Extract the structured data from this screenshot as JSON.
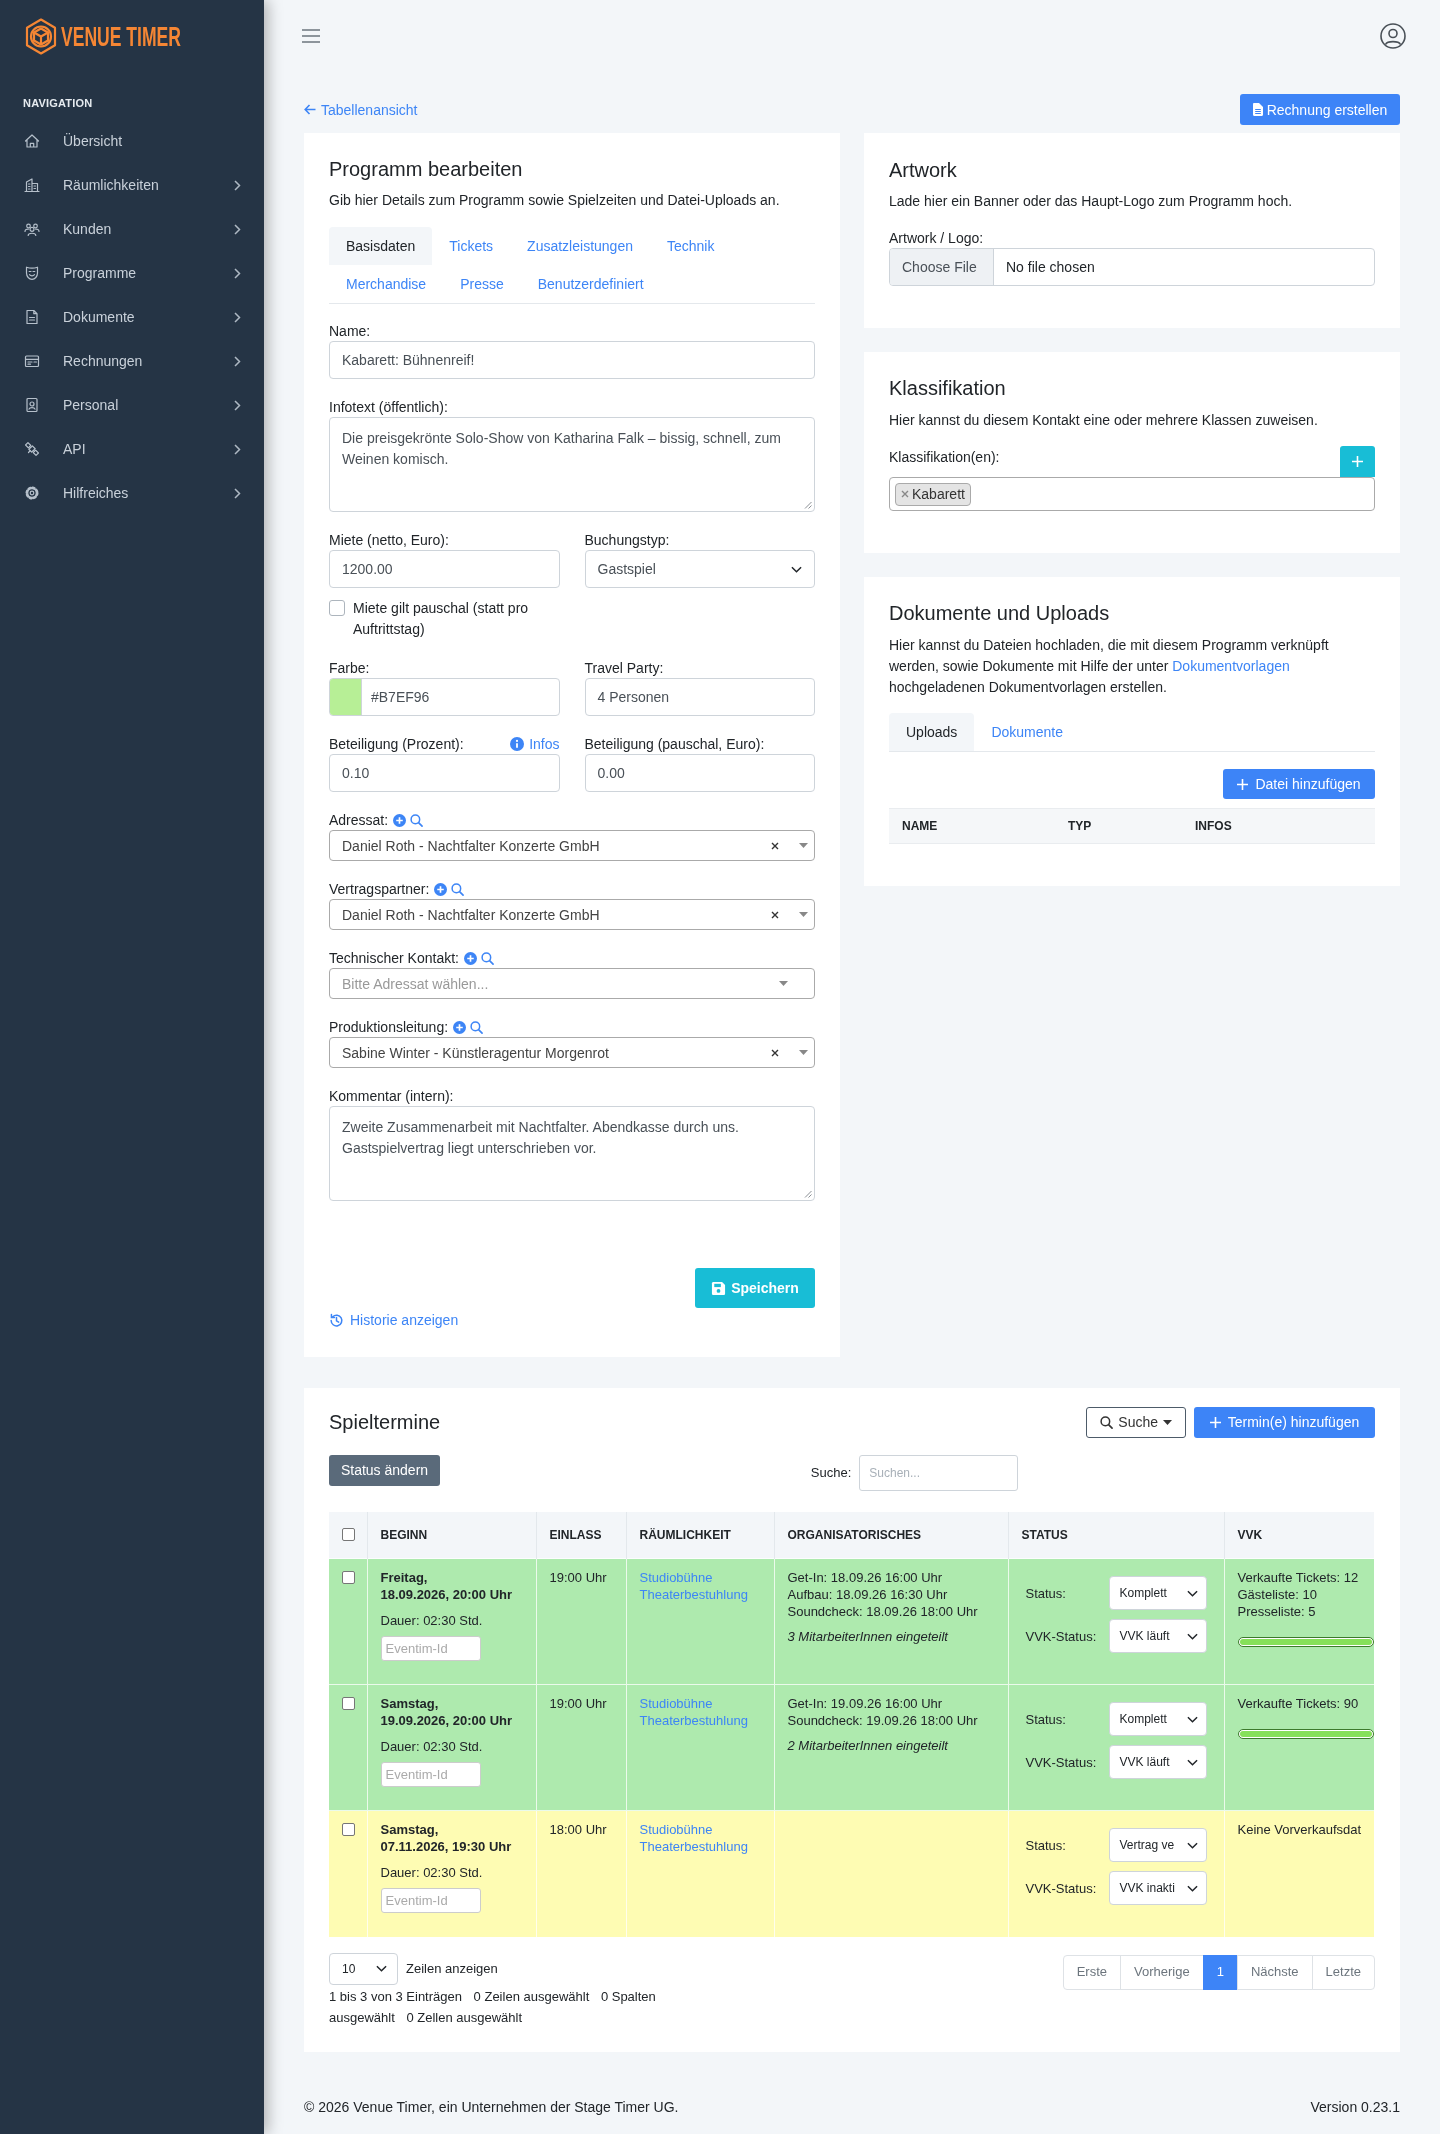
{
  "sidebar": {
    "logo": "VENUE TIMER",
    "heading": "NAVIGATION",
    "items": [
      {
        "label": "Übersicht",
        "submenu": false,
        "selected": false
      },
      {
        "label": "Räumlichkeiten",
        "submenu": true,
        "selected": false
      },
      {
        "label": "Kunden",
        "submenu": true,
        "selected": false
      },
      {
        "label": "Programme",
        "submenu": true,
        "selected": false
      },
      {
        "label": "Dokumente",
        "submenu": true,
        "selected": false
      },
      {
        "label": "Rechnungen",
        "submenu": true,
        "selected": false
      },
      {
        "label": "Personal",
        "submenu": true,
        "selected": false
      },
      {
        "label": "API",
        "submenu": true,
        "selected": false
      },
      {
        "label": "Hilfreiches",
        "submenu": true,
        "selected": false
      }
    ]
  },
  "toolbar": {
    "back_link": "Tabellenansicht",
    "invoice_button": "Rechnung erstellen"
  },
  "program_form": {
    "title": "Programm bearbeiten",
    "description": "Gib hier Details zum Programm sowie Spielzeiten und Datei-Uploads an.",
    "tabs": [
      {
        "label": "Basisdaten",
        "selected": true
      },
      {
        "label": "Tickets",
        "selected": false
      },
      {
        "label": "Zusatzleistungen",
        "selected": false
      },
      {
        "label": "Technik",
        "selected": false
      },
      {
        "label": "Merchandise",
        "selected": false
      },
      {
        "label": "Presse",
        "selected": false
      },
      {
        "label": "Benutzerdefiniert",
        "selected": false
      }
    ],
    "rows": [
      [
        [
          {
            "kind": "text",
            "label": "Name:",
            "value": "Kabarett: Bühnenreif!"
          }
        ]
      ],
      [
        [
          {
            "kind": "textarea",
            "label": "Infotext (öffentlich):",
            "value": "Die preisgekrönte Solo-Show von Katharina Falk – bissig, schnell, zum Weinen komisch."
          }
        ]
      ],
      [
        [
          {
            "kind": "text",
            "label": "Miete (netto, Euro):",
            "value": "1200.00"
          },
          {
            "kind": "checkbox",
            "label": "Miete gilt pauschal (statt pro Auftrittstag)",
            "checked": false
          }
        ],
        [
          {
            "kind": "dropdown",
            "label": "Buchungstyp:",
            "value": "Gastspiel"
          }
        ]
      ],
      [
        [
          {
            "kind": "color",
            "label": "Farbe:",
            "value": "#B7EF96"
          }
        ],
        [
          {
            "kind": "text",
            "label": "Travel Party:",
            "value": "4 Personen"
          }
        ]
      ],
      [
        [
          {
            "kind": "text",
            "label": "Beteiligung (Prozent):",
            "value": "0.10",
            "info_link": "Infos"
          }
        ],
        [
          {
            "kind": "text",
            "label": "Beteiligung (pauschal, Euro):",
            "value": "0.00"
          }
        ]
      ],
      [
        [
          {
            "kind": "contact",
            "label": "Adressat:",
            "value": "Daniel Roth - Nachtfalter Konzerte GmbH"
          }
        ]
      ],
      [
        [
          {
            "kind": "contact",
            "label": "Vertragspartner:",
            "value": "Daniel Roth - Nachtfalter Konzerte GmbH"
          }
        ]
      ],
      [
        [
          {
            "kind": "contact",
            "label": "Technischer Kontakt:",
            "placeholder": "Bitte Adressat wählen..."
          }
        ]
      ],
      [
        [
          {
            "kind": "contact",
            "label": "Produktionsleitung:",
            "value": "Sabine Winter - Künstleragentur Morgenrot"
          }
        ]
      ],
      [
        [
          {
            "kind": "textarea",
            "label": "Kommentar (intern):",
            "value": "Zweite Zusammenarbeit mit Nachtfalter. Abendkasse durch uns. Gastspielvertrag liegt unterschrieben vor."
          }
        ]
      ]
    ],
    "save_button": "Speichern",
    "history_link": "Historie anzeigen"
  },
  "artwork": {
    "title": "Artwork",
    "description": "Lade hier ein Banner oder das Haupt-Logo zum Programm hoch.",
    "label": "Artwork / Logo:",
    "file_button": "Choose File",
    "file_status": "No file chosen"
  },
  "classification": {
    "title": "Klassifikation",
    "description": "Hier kannst du diesem Kontakt eine oder mehrere Klassen zuweisen.",
    "label": "Klassifikation(en):",
    "tags": [
      "Kabarett"
    ]
  },
  "documents": {
    "title": "Dokumente und Uploads",
    "description": {
      "before": "Hier kannst du Dateien hochladen, die mit diesem Programm verknüpft werden, sowie Dokumente mit Hilfe der unter",
      "link": "Dokumentvorlagen",
      "after": "hochgeladenen Dokumentvorlagen erstellen."
    },
    "tabs": [
      {
        "label": "Uploads",
        "selected": true
      },
      {
        "label": "Dokumente",
        "selected": false
      }
    ],
    "add_button": "Datei hinzufügen",
    "columns": [
      "NAME",
      "TYP",
      "INFOS"
    ]
  },
  "schedule": {
    "title": "Spieltermine",
    "search_button": "Suche",
    "add_button": "Termin(e) hinzufügen",
    "status_button": "Status ändern",
    "search_label": "Suche:",
    "search_placeholder": "Suchen...",
    "select_all_checked": false,
    "columns": [
      "BEGINN",
      "EINLASS",
      "RÄUMLICHKEIT",
      "ORGANISATORISCHES",
      "STATUS",
      "VVK"
    ],
    "rows": [
      {
        "color": "#aeeaae",
        "checked": false,
        "day": "Freitag,",
        "datetime": "18.09.2026, 20:00 Uhr",
        "duration": "Dauer: 02:30 Std.",
        "eventim_placeholder": "Eventim-Id",
        "admission": "19:00 Uhr",
        "venue": "Studiobühne Theaterbestuhlung",
        "organisation": [
          "Get-In: 18.09.26 16:00 Uhr",
          "Aufbau: 18.09.26 16:30 Uhr",
          "Soundcheck: 18.09.26 18:00 Uhr"
        ],
        "staff": "3 MitarbeiterInnen eingeteilt",
        "status_label": "Status:",
        "status": "Komplett",
        "vvk_status_label": "VVK-Status:",
        "vvk_status": "VVK läuft",
        "sales": [
          "Verkaufte Tickets: 12",
          "Gästeliste: 10",
          "Presseliste: 5"
        ],
        "sales_bar": {
          "level": 1
        }
      },
      {
        "color": "#aeeaae",
        "checked": false,
        "day": "Samstag,",
        "datetime": "19.09.2026, 20:00 Uhr",
        "duration": "Dauer: 02:30 Std.",
        "eventim_placeholder": "Eventim-Id",
        "admission": "19:00 Uhr",
        "venue": "Studiobühne Theaterbestuhlung",
        "organisation": [
          "Get-In: 19.09.26 16:00 Uhr",
          "Soundcheck: 19.09.26 18:00 Uhr"
        ],
        "staff": "2 MitarbeiterInnen eingeteilt",
        "status_label": "Status:",
        "status": "Komplett",
        "vvk_status_label": "VVK-Status:",
        "vvk_status": "VVK läuft",
        "sales": [
          "Verkaufte Tickets: 90"
        ],
        "sales_bar": {
          "level": 1
        }
      },
      {
        "color": "#fefcb3",
        "checked": false,
        "day": "Samstag,",
        "datetime": "07.11.2026, 19:30 Uhr",
        "duration": "Dauer: 02:30 Std.",
        "eventim_placeholder": "Eventim-Id",
        "admission": "18:00 Uhr",
        "venue": "Studiobühne Theaterbestuhlung",
        "status_label": "Status:",
        "status": "Vertrag ve",
        "vvk_status_label": "VVK-Status:",
        "vvk_status": "VVK inakti",
        "sales": [
          "Keine Vorverkaufsdat"
        ]
      }
    ],
    "page_length": "10",
    "page_length_label": "Zeilen anzeigen",
    "info": [
      "1 bis 3 von 3 Einträgen",
      "0 Zeilen ausgewählt",
      "0 Spalten ausgewählt",
      "0 Zellen ausgewählt"
    ],
    "pagination": [
      {
        "label": "Erste",
        "selected": false,
        "disabled": true
      },
      {
        "label": "Vorherige",
        "selected": false,
        "disabled": true
      },
      {
        "label": "1",
        "selected": true,
        "disabled": false
      },
      {
        "label": "Nächste",
        "selected": false,
        "disabled": true
      },
      {
        "label": "Letzte",
        "selected": false,
        "disabled": true
      }
    ]
  },
  "footer": {
    "copyright": "© 2026 Venue Timer, ein Unternehmen der Stage Timer UG.",
    "version": "Version 0.23.1"
  }
}
